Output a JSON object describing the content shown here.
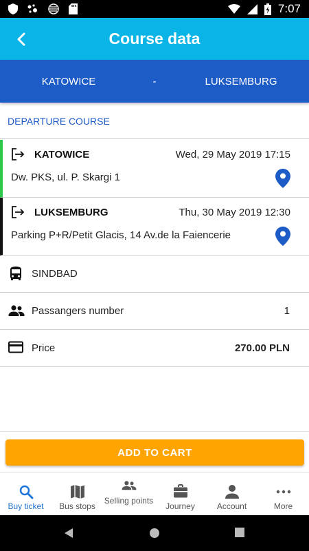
{
  "status_bar": {
    "time": "7:07",
    "icons": [
      "shield-icon",
      "assistant-dots-icon",
      "circle-pattern-icon",
      "sd-card-icon",
      "wifi-icon",
      "signal-icon",
      "battery-charging-icon"
    ]
  },
  "app_bar": {
    "title": "Course data",
    "back_icon": "back-arrow-icon"
  },
  "route": {
    "from": "KATOWICE",
    "separator": "-",
    "to": "LUKSEMBURG"
  },
  "section": {
    "title": "DEPARTURE COURSE"
  },
  "departure": {
    "city": "KATOWICE",
    "datetime": "Wed, 29 May 2019 17:15",
    "address": "Dw. PKS, ul. P. Skargi 1",
    "accent_color": "#2ec84a"
  },
  "arrival": {
    "city": "LUKSEMBURG",
    "datetime": "Thu, 30 May 2019 12:30",
    "address": "Parking P+R/Petit Glacis, 14 Av.de la Faiencerie",
    "accent_color": "#111111"
  },
  "details": {
    "carrier": "SINDBAD",
    "passengers_label": "Passangers number",
    "passengers_value": "1",
    "price_label": "Price",
    "price_value": "270.00 PLN"
  },
  "cart": {
    "button_label": "ADD TO CART",
    "color": "#ffa400"
  },
  "bottom_nav": {
    "items": [
      {
        "label": "Buy ticket",
        "icon": "search-icon",
        "active": true
      },
      {
        "label": "Bus stops",
        "icon": "map-icon",
        "active": false
      },
      {
        "label": "Selling points",
        "icon": "people-icon",
        "active": false
      },
      {
        "label": "Journey",
        "icon": "briefcase-icon",
        "active": false
      },
      {
        "label": "Account",
        "icon": "person-icon",
        "active": false
      },
      {
        "label": "More",
        "icon": "more-dots-icon",
        "active": false
      }
    ],
    "active_color": "#1d74d6"
  },
  "colors": {
    "app_bar": "#0ab4e6",
    "route_bar": "#1d5bc6",
    "section_title": "#1d5bc6",
    "pin": "#1d5bc6"
  }
}
